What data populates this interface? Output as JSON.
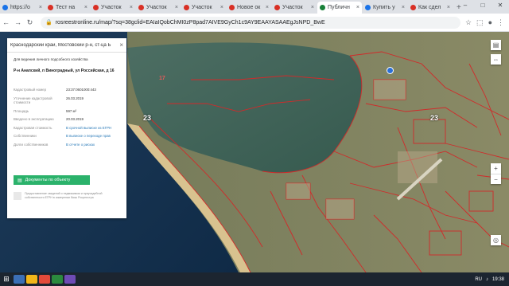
{
  "tabs": [
    {
      "label": "https://o",
      "fav": "blue"
    },
    {
      "label": "Тест на",
      "fav": "red"
    },
    {
      "label": "Участок",
      "fav": "red"
    },
    {
      "label": "Участок",
      "fav": "red"
    },
    {
      "label": "Участок",
      "fav": "red"
    },
    {
      "label": "Новое ок",
      "fav": "red"
    },
    {
      "label": "Участок",
      "fav": "red"
    },
    {
      "label": "Публичн",
      "fav": "green",
      "active": true
    },
    {
      "label": "Купить у",
      "fav": "blue"
    },
    {
      "label": "Как сдел",
      "fav": "red"
    }
  ],
  "toolbar": {
    "url": "rosreestronline.ru/map/?sq=38gclid=EAIaIQobChMI0zP8pad7AIVE9GyCh1c9AY9EAAYASAAEgJsNPD_BwE"
  },
  "map": {
    "region_labels": [
      "23",
      "23"
    ],
    "parcel_labels": [
      "17"
    ]
  },
  "panel": {
    "search_value": "Краснодарский край, Мостовский р-н, ст-ца Б",
    "description": "Для ведения личного подсобного хозяйства",
    "address": "Р-н Анапский, п Виноградный, ул Российская, д 16",
    "rows": [
      {
        "key": "Кадастровый номер",
        "value": "23:37:0601000:443",
        "link": false
      },
      {
        "key": "Уточнение кадастровой стоимости",
        "value": "26.03.2019",
        "link": false
      },
      {
        "key": "Площадь",
        "value": "597 м²",
        "link": false
      },
      {
        "key": "Введено в эксплуатацию",
        "value": "20.03.2019",
        "link": false
      },
      {
        "key": "Кадастровая стоимость",
        "value": "В срочной выписке из ЕГРН",
        "link": true
      },
      {
        "key": "Собственники",
        "value": "В выписке о переходе прав",
        "link": true
      },
      {
        "key": "Долги собственников",
        "value": "В отчете о рисках",
        "link": true
      }
    ],
    "docs_button": "Документы по объекту",
    "footer": "Предоставление сведений о недвижимом и приусадебной собственности ЕГРН в измерении базы Росреестра"
  },
  "taskbar": {
    "time": "19:38"
  }
}
